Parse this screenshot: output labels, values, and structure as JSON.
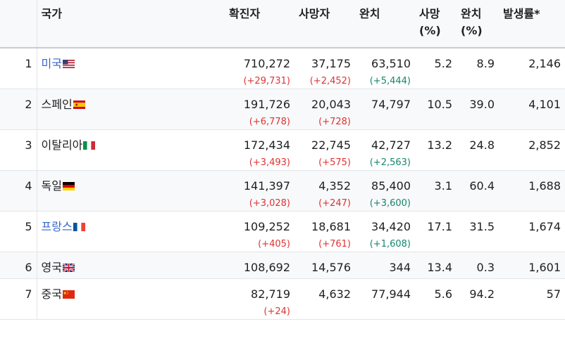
{
  "headers": {
    "country": "국가",
    "confirmed": "확진자",
    "deaths": "사망자",
    "recovered": "완치",
    "death_rate": [
      "사망",
      "(%)"
    ],
    "recovery_rate": [
      "완치",
      "(%)"
    ],
    "incidence": "발생률*"
  },
  "rows": [
    {
      "rank": "1",
      "country": "미국",
      "flag": "us-flag-icon",
      "link": true,
      "confirmed": "710,272",
      "confirmed_delta": "(+29,731)",
      "deaths": "37,175",
      "deaths_delta": "(+2,452)",
      "recovered": "63,510",
      "recovered_delta": "(+5,444)",
      "death_rate": "5.2",
      "recovery_rate": "8.9",
      "incidence": "2,146"
    },
    {
      "rank": "2",
      "country": "스페인",
      "flag": "es-flag-icon",
      "link": false,
      "confirmed": "191,726",
      "confirmed_delta": "(+6,778)",
      "deaths": "20,043",
      "deaths_delta": "(+728)",
      "recovered": "74,797",
      "recovered_delta": "",
      "death_rate": "10.5",
      "recovery_rate": "39.0",
      "incidence": "4,101"
    },
    {
      "rank": "3",
      "country": "이탈리아",
      "flag": "it-flag-icon",
      "link": false,
      "confirmed": "172,434",
      "confirmed_delta": "(+3,493)",
      "deaths": "22,745",
      "deaths_delta": "(+575)",
      "recovered": "42,727",
      "recovered_delta": "(+2,563)",
      "death_rate": "13.2",
      "recovery_rate": "24.8",
      "incidence": "2,852"
    },
    {
      "rank": "4",
      "country": "독일",
      "flag": "de-flag-icon",
      "link": false,
      "confirmed": "141,397",
      "confirmed_delta": "(+3,028)",
      "deaths": "4,352",
      "deaths_delta": "(+247)",
      "recovered": "85,400",
      "recovered_delta": "(+3,600)",
      "death_rate": "3.1",
      "recovery_rate": "60.4",
      "incidence": "1,688"
    },
    {
      "rank": "5",
      "country": "프랑스",
      "flag": "fr-flag-icon",
      "link": true,
      "confirmed": "109,252",
      "confirmed_delta": "(+405)",
      "deaths": "18,681",
      "deaths_delta": "(+761)",
      "recovered": "34,420",
      "recovered_delta": "(+1,608)",
      "death_rate": "17.1",
      "recovery_rate": "31.5",
      "incidence": "1,674"
    },
    {
      "rank": "6",
      "country": "영국",
      "flag": "uk-flag-icon",
      "link": false,
      "confirmed": "108,692",
      "confirmed_delta": "",
      "deaths": "14,576",
      "deaths_delta": "",
      "recovered": "344",
      "recovered_delta": "",
      "death_rate": "13.4",
      "recovery_rate": "0.3",
      "incidence": "1,601"
    },
    {
      "rank": "7",
      "country": "중국",
      "flag": "cn-flag-icon",
      "link": false,
      "confirmed": "82,719",
      "confirmed_delta": "(+24)",
      "deaths": "4,632",
      "deaths_delta": "",
      "recovered": "77,944",
      "recovered_delta": "",
      "death_rate": "5.6",
      "recovery_rate": "94.2",
      "incidence": "57"
    }
  ]
}
